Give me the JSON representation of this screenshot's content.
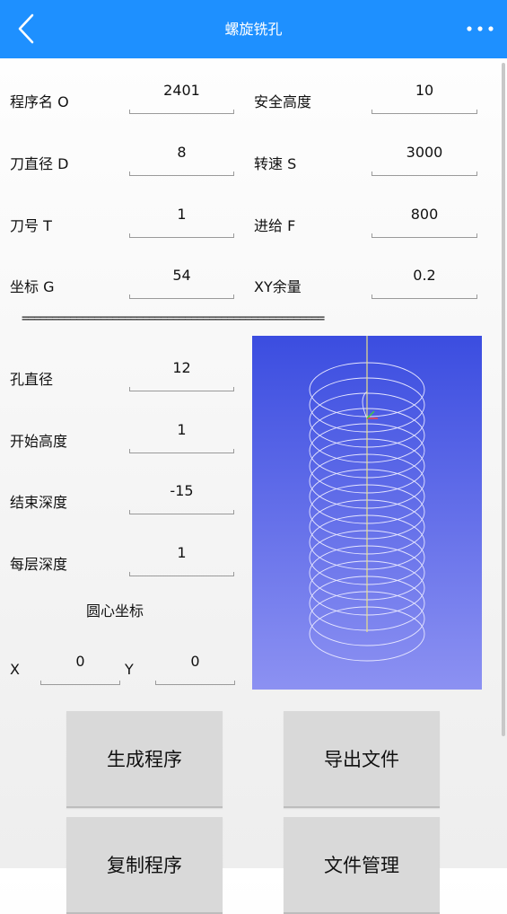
{
  "appbar": {
    "title": "螺旋铣孔"
  },
  "params": {
    "program_name_label": "程序名 O",
    "program_name_value": "2401",
    "safe_height_label": "安全高度",
    "safe_height_value": "10",
    "tool_diameter_label": "刀直径 D",
    "tool_diameter_value": "8",
    "spindle_speed_label": "转速 S",
    "spindle_speed_value": "3000",
    "tool_number_label": "刀号 T",
    "tool_number_value": "1",
    "feed_label": "进给 F",
    "feed_value": "800",
    "coordinate_label": "坐标 G",
    "coordinate_value": "54",
    "xy_allowance_label": "XY余量",
    "xy_allowance_value": "0.2"
  },
  "separator": "==================================================",
  "hole": {
    "hole_diameter_label": "孔直径",
    "hole_diameter_value": "12",
    "start_height_label": "开始高度",
    "start_height_value": "1",
    "end_depth_label": "结束深度",
    "end_depth_value": "-15",
    "layer_depth_label": "每层深度",
    "layer_depth_value": "1",
    "center_label": "圆心坐标",
    "x_label": "X",
    "x_value": "0",
    "y_label": "Y",
    "y_value": "0"
  },
  "buttons": {
    "generate": "生成程序",
    "export": "导出文件",
    "copy": "复制程序",
    "file_manager": "文件管理"
  },
  "colors": {
    "appbar": "#1e90ff",
    "preview_top": "#3b4de0",
    "preview_bottom": "#8c91f2"
  }
}
